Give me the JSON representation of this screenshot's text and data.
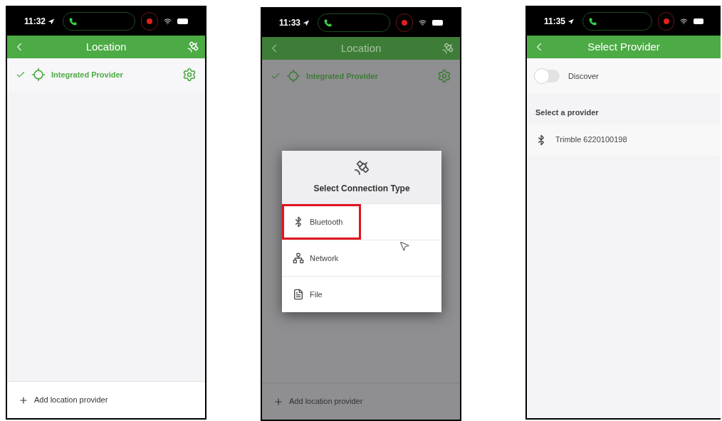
{
  "screens": [
    {
      "kind": "location",
      "time": "11:32",
      "title": "Location",
      "dimmed": false,
      "providers": [
        {
          "name": "Integrated Provider",
          "checked": true
        }
      ],
      "footer": "Add location provider"
    },
    {
      "kind": "location",
      "time": "11:33",
      "title": "Location",
      "dimmed": true,
      "providers": [
        {
          "name": "Integrated Provider",
          "checked": true
        }
      ],
      "footer": "Add location provider",
      "dialog": {
        "title": "Select Connection Type",
        "options": [
          {
            "kind": "bluetooth",
            "label": "Bluetooth",
            "highlighted": true
          },
          {
            "kind": "network",
            "label": "Network",
            "highlighted": false
          },
          {
            "kind": "file",
            "label": "File",
            "highlighted": false
          }
        ]
      }
    },
    {
      "kind": "select_provider",
      "time": "11:35",
      "title": "Select Provider",
      "discover": {
        "label": "Discover",
        "on": false
      },
      "section": "Select a provider",
      "devices": [
        {
          "name": "Trimble 6220100198"
        }
      ]
    }
  ]
}
